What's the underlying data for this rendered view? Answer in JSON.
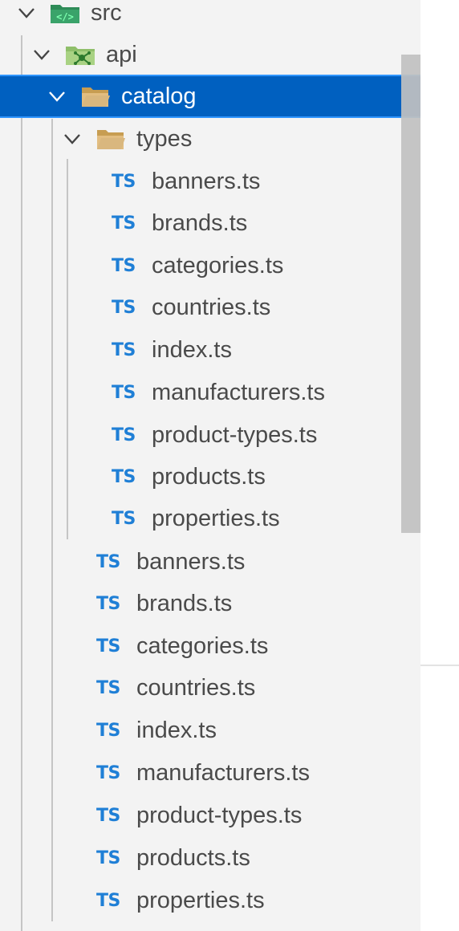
{
  "tree": {
    "src": {
      "label": "src",
      "icon": "src-folder-icon"
    },
    "api": {
      "label": "api",
      "icon": "api-folder-icon"
    },
    "catalog": {
      "label": "catalog",
      "icon": "folder-open-icon"
    },
    "types": {
      "label": "types",
      "icon": "folder-open-icon"
    },
    "types_files": [
      {
        "badge": "TS",
        "label": "banners.ts"
      },
      {
        "badge": "TS",
        "label": "brands.ts"
      },
      {
        "badge": "TS",
        "label": "categories.ts"
      },
      {
        "badge": "TS",
        "label": "countries.ts"
      },
      {
        "badge": "TS",
        "label": "index.ts"
      },
      {
        "badge": "TS",
        "label": "manufacturers.ts"
      },
      {
        "badge": "TS",
        "label": "product-types.ts"
      },
      {
        "badge": "TS",
        "label": "products.ts"
      },
      {
        "badge": "TS",
        "label": "properties.ts"
      }
    ],
    "catalog_files": [
      {
        "badge": "TS",
        "label": "banners.ts"
      },
      {
        "badge": "TS",
        "label": "brands.ts"
      },
      {
        "badge": "TS",
        "label": "categories.ts"
      },
      {
        "badge": "TS",
        "label": "countries.ts"
      },
      {
        "badge": "TS",
        "label": "index.ts"
      },
      {
        "badge": "TS",
        "label": "manufacturers.ts"
      },
      {
        "badge": "TS",
        "label": "product-types.ts"
      },
      {
        "badge": "TS",
        "label": "products.ts"
      },
      {
        "badge": "TS",
        "label": "properties.ts"
      }
    ]
  },
  "colors": {
    "selection": "#0060c0",
    "ts_badge": "#1f7fd6",
    "folder": "#d9b77e",
    "src_folder": "#2e8b57"
  }
}
